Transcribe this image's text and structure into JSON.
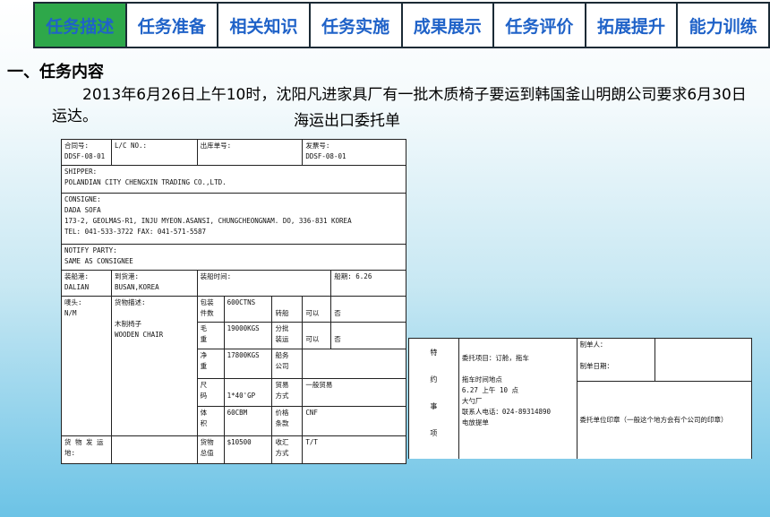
{
  "tabs": [
    {
      "label": "任务描述",
      "active": true
    },
    {
      "label": "任务准备",
      "active": false
    },
    {
      "label": "相关知识",
      "active": false
    },
    {
      "label": "任务实施",
      "active": false
    },
    {
      "label": "成果展示",
      "active": false
    },
    {
      "label": "任务评价",
      "active": false
    },
    {
      "label": "拓展提升",
      "active": false
    },
    {
      "label": "能力训练",
      "active": false
    }
  ],
  "colors": {
    "active_tab": "#2ea84a",
    "tab_text": "#1f62c8"
  },
  "section": {
    "title": "一、任务内容",
    "paragraph": "2013年6月26日上午10时，沈阳凡进家具厂有一批木质椅子要运到韩国釜山明朗公司要求6月30日运达。",
    "form_caption": "海运出口委托单"
  },
  "form": {
    "contract_no_label": "合同号:",
    "contract_no": "DDSF-08-01",
    "lc_no_label": "L/C NO.:",
    "delivery_no_label": "出库单号:",
    "invoice_no_label": "发票号:",
    "invoice_no": "DDSF-08-01",
    "shipper_label": "SHIPPER:",
    "shipper": "POLANDIAN CITY CHENGXIN TRADING CO.,LTD.",
    "consignee_label": "CONSIGNE:",
    "consignee_name": "DADA SOFA",
    "consignee_addr": "173-2, GEOLMAS-R1, INJU MYEON.ASANSI, CHUNGCHEONGNAM. DO, 336-831 KOREA",
    "consignee_tel": "TEL: 041-533-3722  FAX: 041-571-5587",
    "notify_label": "NOTIFY PARTY:",
    "notify": "SAME AS CONSIGNEE",
    "pol_label": "装船港:",
    "pol": "DALIAN",
    "pod_label": "到货港:",
    "pod": "BUSAN,KOREA",
    "ship_time_label": "装船时间:",
    "vessel_label": "船期:",
    "vessel": "6.26",
    "marks_label": "唛头:",
    "marks": "N/M",
    "desc_label": "货物描述:",
    "desc_cn": "木制椅子",
    "desc_en": "WOODEN CHAIR",
    "pkg_label_1": "包装",
    "pkg_label_2": "件数",
    "pkg_value": "600CTNS",
    "transship_label": "转船",
    "allowed": "可以",
    "not_allowed": "否",
    "gross_label_1": "毛",
    "gross_label_2": "重",
    "gross_value": "19000KGS",
    "partial_label_1": "分批",
    "partial_label_2": "装运",
    "net_label_1": "净",
    "net_label_2": "重",
    "net_value": "17800KGS",
    "ship_co_label_1": "船务",
    "ship_co_label_2": "公司",
    "size_label_1": "尺",
    "size_label_2": "码",
    "size_value": "1*40'GP",
    "trade_label_1": "贸易",
    "trade_label_2": "方式",
    "trade_value": "一般贸易",
    "volume_label_1": "体",
    "volume_label_2": "积",
    "volume_value": "60CBM",
    "price_label_1": "价格",
    "price_label_2": "条款",
    "price_value": "CNF",
    "goods_addr_label_1": "货 物 发 运",
    "goods_addr_label_2": "地:",
    "value_label_1": "货物",
    "value_label_2": "总值",
    "value_value": "$10500",
    "settle_label_1": "收汇",
    "settle_label_2": "方式",
    "settle_value": "T/T"
  },
  "form_right": {
    "special_chars": [
      "特",
      "约",
      "事",
      "项"
    ],
    "entrust_items": "委托项目：订舱，拖车",
    "tow_time_label": "拖车时间地点",
    "tow_time": "6.27 上午 10 点",
    "tow_place": "大勺厂",
    "contact": "联系人电话：024-89314890",
    "bl": "电放提单",
    "maker_label": "制单人：",
    "date_label": "制单日期：",
    "seal": "委托单位印章（一般这个地方会有个公司的印章）"
  }
}
